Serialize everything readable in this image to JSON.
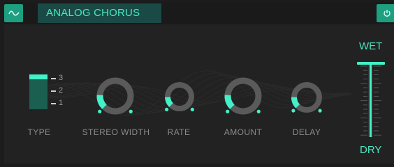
{
  "header": {
    "preset_name": "ANALOG CHORUS"
  },
  "icons": {
    "wave": "sine-wave-icon",
    "power": "power-icon"
  },
  "colors": {
    "accent": "#44f0c8",
    "accent_dark": "#1d9f80",
    "name_bg": "#1a4a45",
    "label": "#8a8a8a",
    "background": "#222222"
  },
  "type_selector": {
    "label": "TYPE",
    "options": [
      "3",
      "2",
      "1"
    ],
    "selected": "3"
  },
  "knobs": [
    {
      "label": "STEREO WIDTH",
      "value": 0.18
    },
    {
      "label": "RATE",
      "value": 0.16
    },
    {
      "label": "AMOUNT",
      "value": 0.18
    },
    {
      "label": "DELAY",
      "value": 0.17
    }
  ],
  "mix": {
    "top_label": "WET",
    "bottom_label": "DRY",
    "value": 1.0
  }
}
